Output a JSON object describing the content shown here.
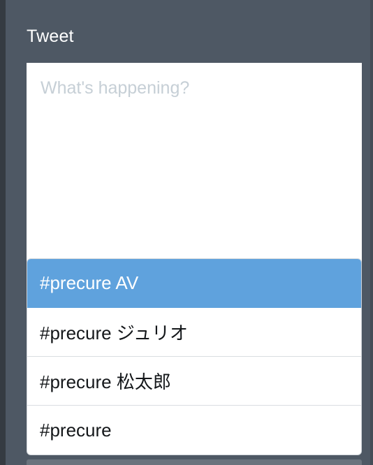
{
  "panel": {
    "title": "Tweet"
  },
  "compose": {
    "value": "",
    "placeholder": "What's happening?"
  },
  "suggestions": {
    "active_index": 0,
    "items": [
      {
        "label": "#precure AV"
      },
      {
        "label": "#precure ジュリオ"
      },
      {
        "label": "#precure 松太郎"
      },
      {
        "label": "#precure"
      }
    ]
  },
  "colors": {
    "panel_bg": "#4e5864",
    "highlight": "#5fa2dd",
    "placeholder": "#c6cfd6"
  }
}
